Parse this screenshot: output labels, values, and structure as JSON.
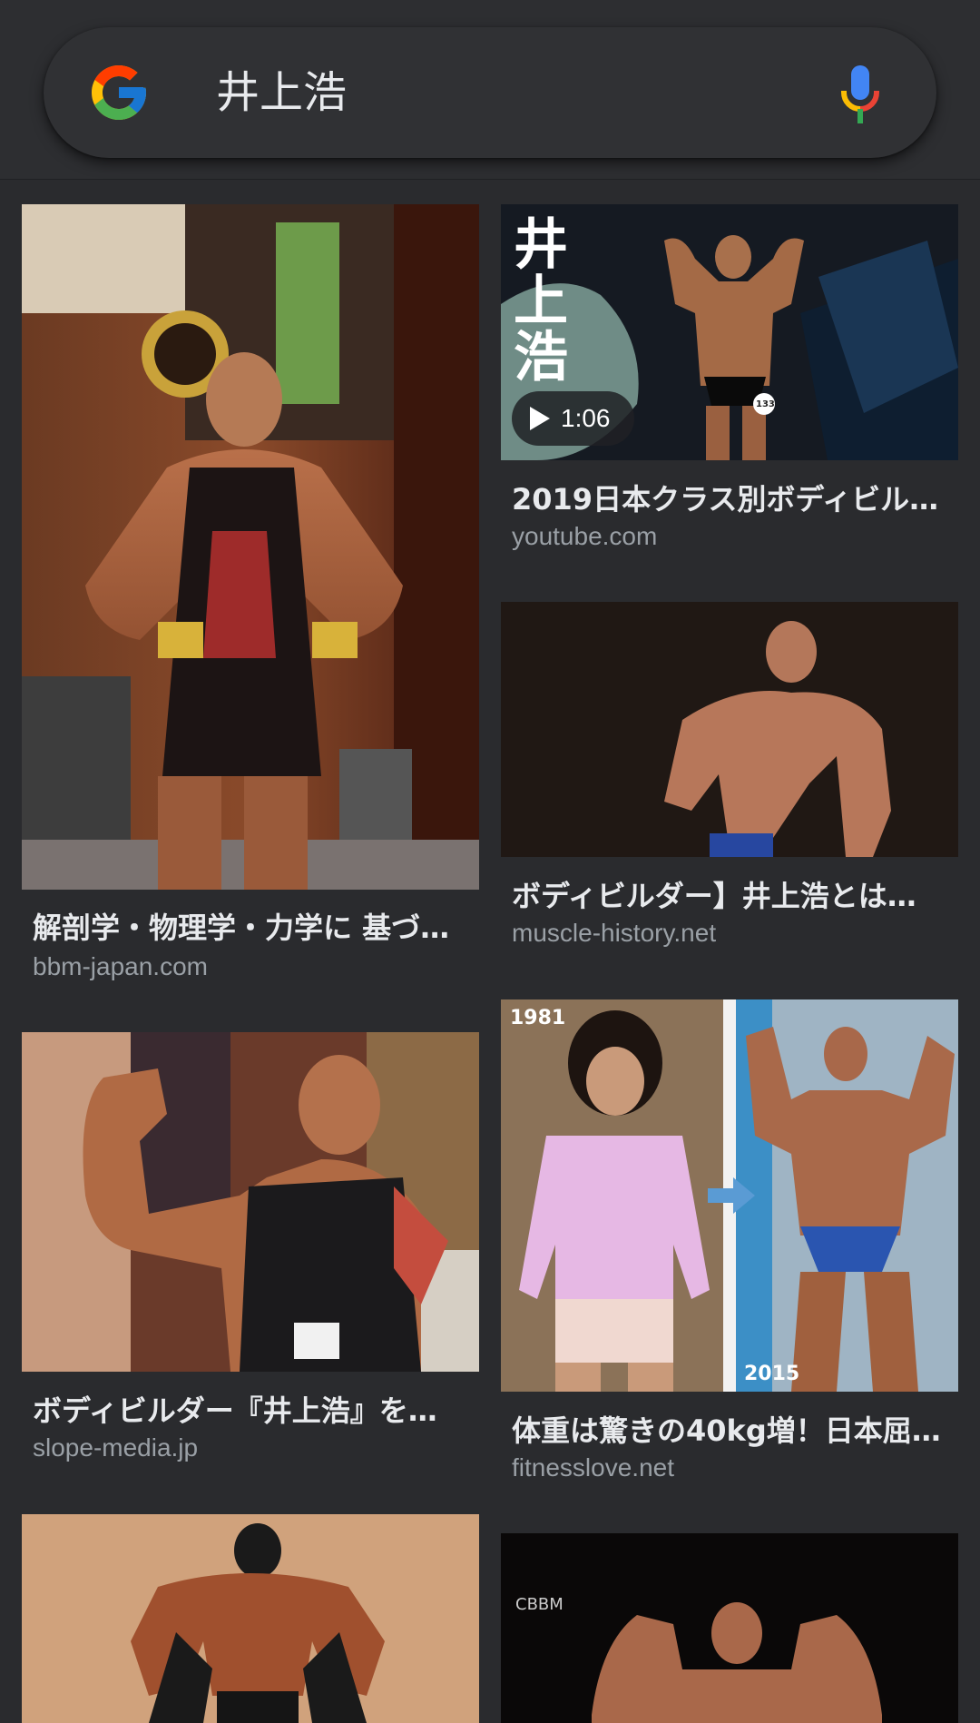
{
  "search": {
    "query": "井上浩"
  },
  "results": [
    {
      "caption": "解剖学・物理学・力学に 基づ…",
      "domain": "bbm-japan.com",
      "image": "bodybuilder in gold's gym tank top"
    },
    {
      "caption": "2019日本クラス別ボディビル…",
      "domain": "youtube.com",
      "image": "bodybuilder posing on stage video",
      "duration": "1:06",
      "overlay": [
        "井",
        "上",
        "浩"
      ],
      "badge": "133"
    },
    {
      "caption": "ボディビルダー】井上浩とは…",
      "domain": "muscle-history.net",
      "image": "bodybuilder posing on dark stage"
    },
    {
      "caption": "ボディビルダー『井上浩』を…",
      "domain": "slope-media.jp",
      "image": "man flexing bicep in store"
    },
    {
      "caption": "体重は驚きの40kg増！日本屈…",
      "domain": "fitnesslove.net",
      "image": "before and after comparison",
      "year_left": "1981",
      "year_right": "2015"
    },
    {
      "caption": "",
      "domain": "",
      "image": "bodybuilder in batman mask"
    },
    {
      "caption": "",
      "domain": "",
      "image": "bodybuilder double bicep pose",
      "watermark": "CBBM"
    }
  ],
  "colors": {
    "background": "#2a2b2e",
    "searchbar": "#303134",
    "title_text": "#e8eaed",
    "domain_text": "#9aa0a6"
  }
}
